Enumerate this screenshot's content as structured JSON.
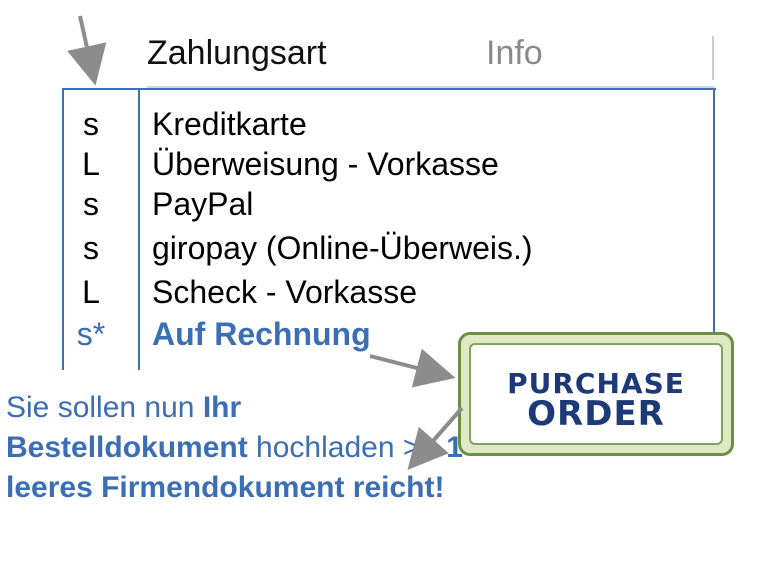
{
  "header": {
    "payment_method": "Zahlungsart",
    "info": "Info"
  },
  "rows": [
    {
      "code": "s",
      "name": "Kreditkarte"
    },
    {
      "code": "L",
      "name": "Überweisung - Vorkasse"
    },
    {
      "code": "s",
      "name": "PayPal"
    },
    {
      "code": "s",
      "name": "giropay (Online-Überweis.)"
    },
    {
      "code": "L",
      "name": "Scheck - Vorkasse"
    },
    {
      "code": "s*",
      "name": "Auf Rechnung"
    }
  ],
  "note": {
    "part1": "Sie sollen nun ",
    "part2": "Ihr Bestelldokument",
    "part3": " hochladen >> ",
    "part4": "1 leeres Firmendokument reicht!"
  },
  "badge": {
    "line1": "PURCHASE",
    "line2": "ORDER"
  },
  "colors": {
    "accent_blue": "#3b6eb5",
    "badge_green": "#6a8f45",
    "badge_text": "#1c3a78"
  }
}
